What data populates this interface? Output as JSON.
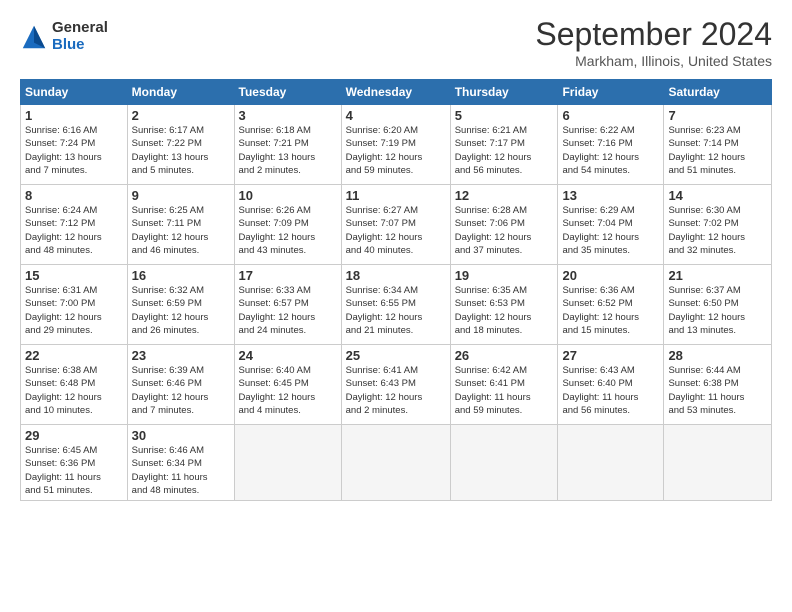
{
  "logo": {
    "general": "General",
    "blue": "Blue"
  },
  "title": "September 2024",
  "location": "Markham, Illinois, United States",
  "headers": [
    "Sunday",
    "Monday",
    "Tuesday",
    "Wednesday",
    "Thursday",
    "Friday",
    "Saturday"
  ],
  "weeks": [
    [
      {
        "day": "1",
        "info": "Sunrise: 6:16 AM\nSunset: 7:24 PM\nDaylight: 13 hours\nand 7 minutes."
      },
      {
        "day": "2",
        "info": "Sunrise: 6:17 AM\nSunset: 7:22 PM\nDaylight: 13 hours\nand 5 minutes."
      },
      {
        "day": "3",
        "info": "Sunrise: 6:18 AM\nSunset: 7:21 PM\nDaylight: 13 hours\nand 2 minutes."
      },
      {
        "day": "4",
        "info": "Sunrise: 6:20 AM\nSunset: 7:19 PM\nDaylight: 12 hours\nand 59 minutes."
      },
      {
        "day": "5",
        "info": "Sunrise: 6:21 AM\nSunset: 7:17 PM\nDaylight: 12 hours\nand 56 minutes."
      },
      {
        "day": "6",
        "info": "Sunrise: 6:22 AM\nSunset: 7:16 PM\nDaylight: 12 hours\nand 54 minutes."
      },
      {
        "day": "7",
        "info": "Sunrise: 6:23 AM\nSunset: 7:14 PM\nDaylight: 12 hours\nand 51 minutes."
      }
    ],
    [
      {
        "day": "8",
        "info": "Sunrise: 6:24 AM\nSunset: 7:12 PM\nDaylight: 12 hours\nand 48 minutes."
      },
      {
        "day": "9",
        "info": "Sunrise: 6:25 AM\nSunset: 7:11 PM\nDaylight: 12 hours\nand 46 minutes."
      },
      {
        "day": "10",
        "info": "Sunrise: 6:26 AM\nSunset: 7:09 PM\nDaylight: 12 hours\nand 43 minutes."
      },
      {
        "day": "11",
        "info": "Sunrise: 6:27 AM\nSunset: 7:07 PM\nDaylight: 12 hours\nand 40 minutes."
      },
      {
        "day": "12",
        "info": "Sunrise: 6:28 AM\nSunset: 7:06 PM\nDaylight: 12 hours\nand 37 minutes."
      },
      {
        "day": "13",
        "info": "Sunrise: 6:29 AM\nSunset: 7:04 PM\nDaylight: 12 hours\nand 35 minutes."
      },
      {
        "day": "14",
        "info": "Sunrise: 6:30 AM\nSunset: 7:02 PM\nDaylight: 12 hours\nand 32 minutes."
      }
    ],
    [
      {
        "day": "15",
        "info": "Sunrise: 6:31 AM\nSunset: 7:00 PM\nDaylight: 12 hours\nand 29 minutes."
      },
      {
        "day": "16",
        "info": "Sunrise: 6:32 AM\nSunset: 6:59 PM\nDaylight: 12 hours\nand 26 minutes."
      },
      {
        "day": "17",
        "info": "Sunrise: 6:33 AM\nSunset: 6:57 PM\nDaylight: 12 hours\nand 24 minutes."
      },
      {
        "day": "18",
        "info": "Sunrise: 6:34 AM\nSunset: 6:55 PM\nDaylight: 12 hours\nand 21 minutes."
      },
      {
        "day": "19",
        "info": "Sunrise: 6:35 AM\nSunset: 6:53 PM\nDaylight: 12 hours\nand 18 minutes."
      },
      {
        "day": "20",
        "info": "Sunrise: 6:36 AM\nSunset: 6:52 PM\nDaylight: 12 hours\nand 15 minutes."
      },
      {
        "day": "21",
        "info": "Sunrise: 6:37 AM\nSunset: 6:50 PM\nDaylight: 12 hours\nand 13 minutes."
      }
    ],
    [
      {
        "day": "22",
        "info": "Sunrise: 6:38 AM\nSunset: 6:48 PM\nDaylight: 12 hours\nand 10 minutes."
      },
      {
        "day": "23",
        "info": "Sunrise: 6:39 AM\nSunset: 6:46 PM\nDaylight: 12 hours\nand 7 minutes."
      },
      {
        "day": "24",
        "info": "Sunrise: 6:40 AM\nSunset: 6:45 PM\nDaylight: 12 hours\nand 4 minutes."
      },
      {
        "day": "25",
        "info": "Sunrise: 6:41 AM\nSunset: 6:43 PM\nDaylight: 12 hours\nand 2 minutes."
      },
      {
        "day": "26",
        "info": "Sunrise: 6:42 AM\nSunset: 6:41 PM\nDaylight: 11 hours\nand 59 minutes."
      },
      {
        "day": "27",
        "info": "Sunrise: 6:43 AM\nSunset: 6:40 PM\nDaylight: 11 hours\nand 56 minutes."
      },
      {
        "day": "28",
        "info": "Sunrise: 6:44 AM\nSunset: 6:38 PM\nDaylight: 11 hours\nand 53 minutes."
      }
    ],
    [
      {
        "day": "29",
        "info": "Sunrise: 6:45 AM\nSunset: 6:36 PM\nDaylight: 11 hours\nand 51 minutes."
      },
      {
        "day": "30",
        "info": "Sunrise: 6:46 AM\nSunset: 6:34 PM\nDaylight: 11 hours\nand 48 minutes."
      },
      {
        "day": "",
        "info": ""
      },
      {
        "day": "",
        "info": ""
      },
      {
        "day": "",
        "info": ""
      },
      {
        "day": "",
        "info": ""
      },
      {
        "day": "",
        "info": ""
      }
    ]
  ]
}
